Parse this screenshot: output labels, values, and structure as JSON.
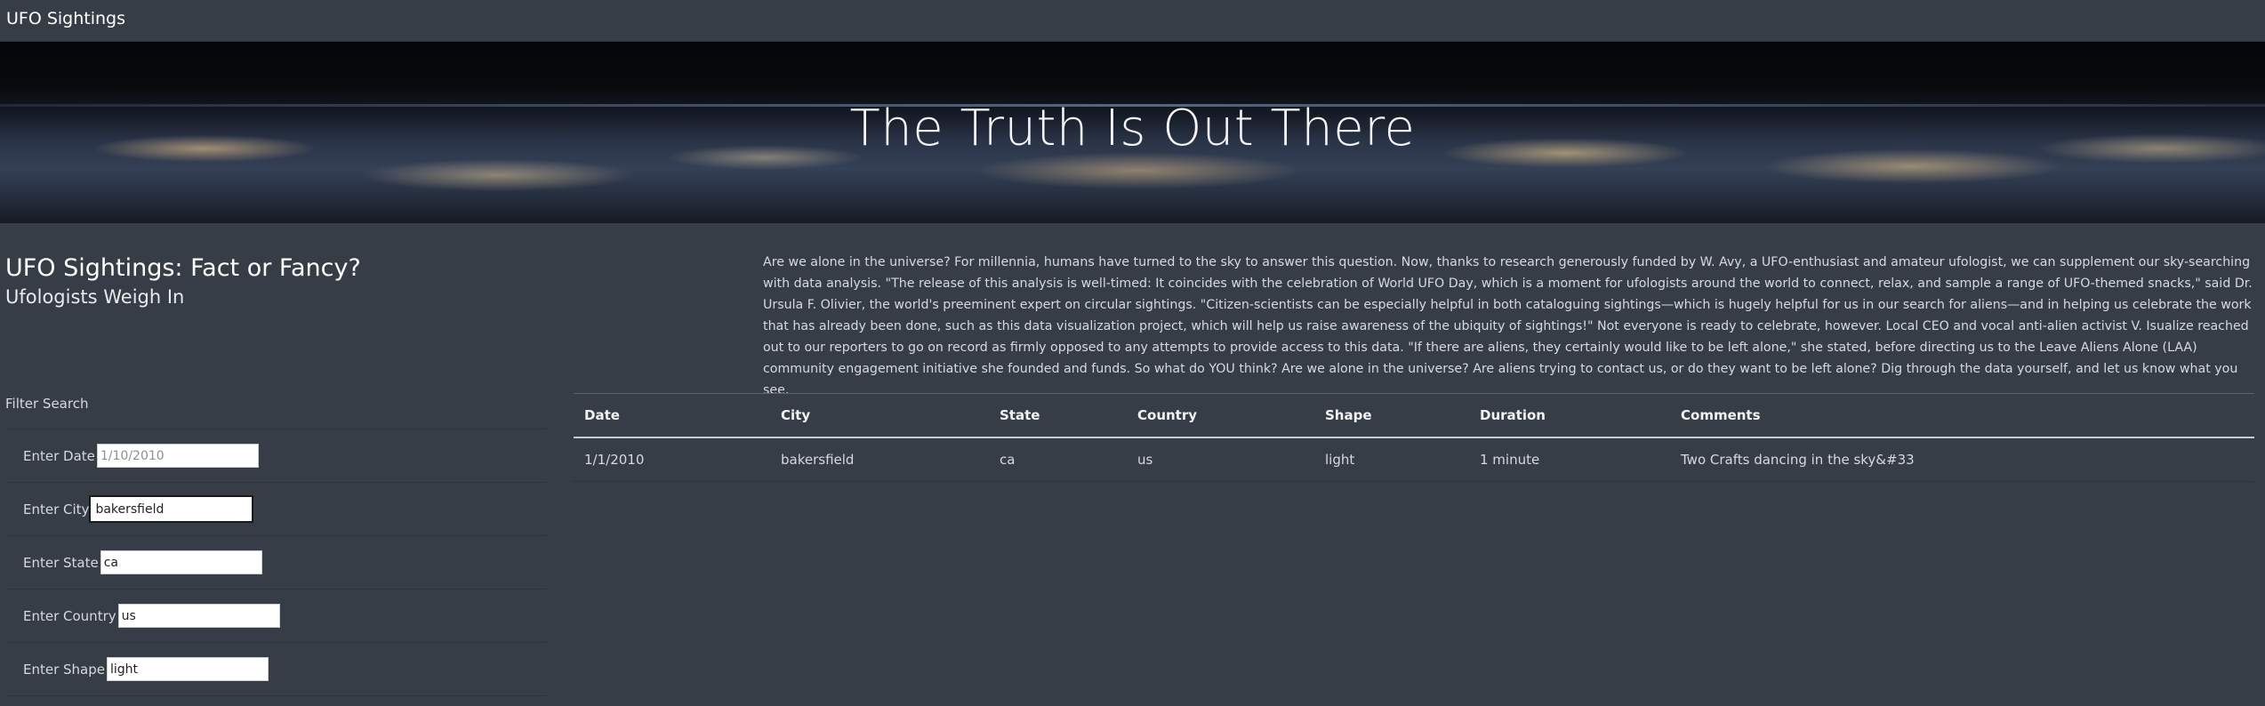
{
  "navbar": {
    "brand": "UFO Sightings"
  },
  "hero": {
    "title": "The Truth Is Out There"
  },
  "intro": {
    "title": "UFO Sightings: Fact or Fancy?",
    "subtitle": "Ufologists Weigh In"
  },
  "article": {
    "text": "Are we alone in the universe? For millennia, humans have turned to the sky to answer this question. Now, thanks to research generously funded by W. Avy, a UFO-enthusiast and amateur ufologist, we can supplement our sky-searching with data analysis. \"The release of this analysis is well-timed: It coincides with the celebration of World UFO Day, which is a moment for ufologists around the world to connect, relax, and sample a range of UFO-themed snacks,\" said Dr. Ursula F. Olivier, the world's preeminent expert on circular sightings. \"Citizen-scientists can be especially helpful in both cataloguing sightings—which is hugely helpful for us in our search for aliens—and in helping us celebrate the work that has already been done, such as this data visualization project, which will help us raise awareness of the ubiquity of sightings!\" Not everyone is ready to celebrate, however. Local CEO and vocal anti-alien activist V. Isualize reached out to our reporters to go on record as firmly opposed to any attempts to provide access to this data. \"If there are aliens, they certainly would like to be left alone,\" she stated, before directing us to the Leave Aliens Alone (LAA) community engagement initiative she founded and funds. So what do YOU think? Are we alone in the universe? Are aliens trying to contact us, or do they want to be left alone? Dig through the data yourself, and let us know what you see."
  },
  "filters": {
    "heading": "Filter Search",
    "date": {
      "label": "Enter Date",
      "value": "",
      "placeholder": "1/10/2010"
    },
    "city": {
      "label": "Enter City",
      "value": "bakersfield",
      "placeholder": ""
    },
    "state": {
      "label": "Enter State",
      "value": "ca",
      "placeholder": ""
    },
    "country": {
      "label": "Enter Country",
      "value": "us",
      "placeholder": ""
    },
    "shape": {
      "label": "Enter Shape",
      "value": "light",
      "placeholder": ""
    }
  },
  "table": {
    "headers": [
      "Date",
      "City",
      "State",
      "Country",
      "Shape",
      "Duration",
      "Comments"
    ],
    "rows": [
      [
        "1/1/2010",
        "bakersfield",
        "ca",
        "us",
        "light",
        "1 minute",
        "Two Crafts dancing in the sky&#33"
      ]
    ]
  }
}
